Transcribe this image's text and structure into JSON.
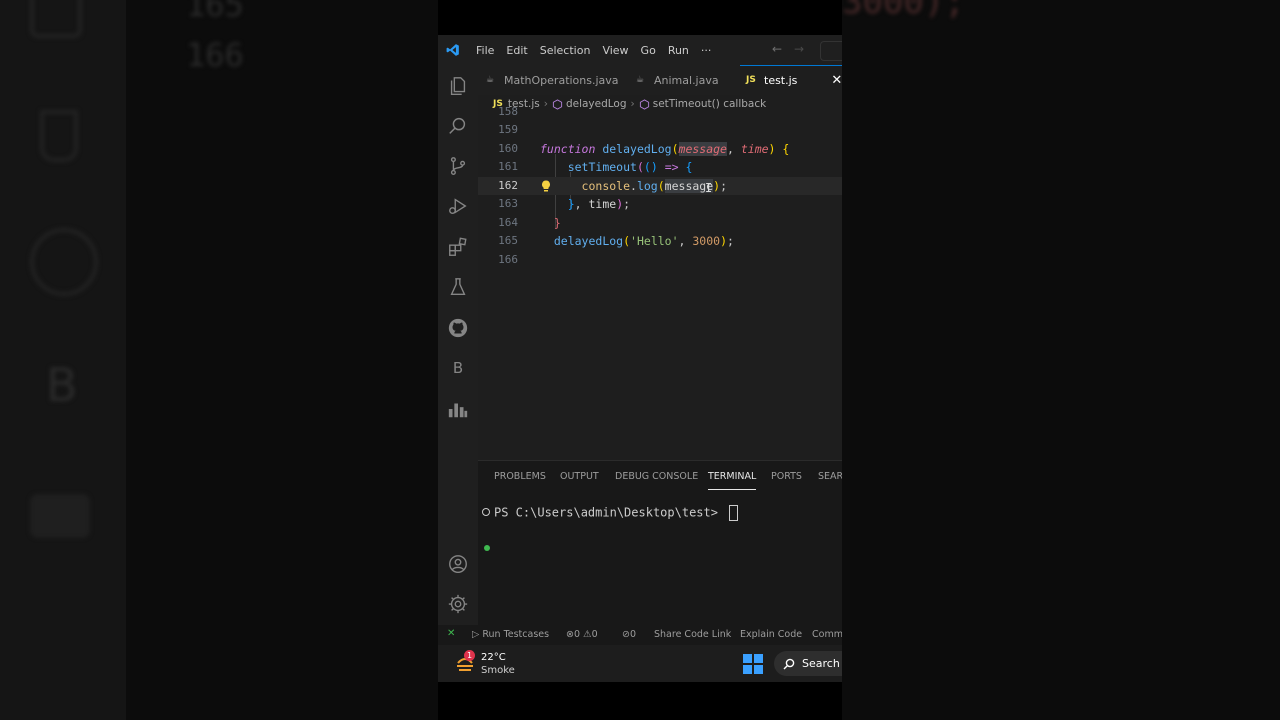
{
  "background_left": {
    "ghost_numbers": [
      "165",
      "166"
    ],
    "ghost_letter": "B"
  },
  "background_right": {
    "ghost_text": "3000);"
  },
  "titlebar": {
    "menu": [
      "File",
      "Edit",
      "Selection",
      "View",
      "Go",
      "Run",
      "···"
    ]
  },
  "tabs": [
    {
      "icon": "☕",
      "label": "MathOperations.java"
    },
    {
      "icon": "☕",
      "label": "Animal.java"
    },
    {
      "icon": "JS",
      "label": "test.js",
      "close": "✕"
    }
  ],
  "breadcrumb": {
    "file_icon": "JS",
    "file": "test.js",
    "symbol": "delayedLog",
    "callback": "setTimeout() callback"
  },
  "code": {
    "line_numbers": [
      "158",
      "159",
      "160",
      "161",
      "162",
      "163",
      "164",
      "165",
      "166"
    ],
    "current_line": "162"
  },
  "panel": {
    "tabs": [
      "PROBLEMS",
      "OUTPUT",
      "DEBUG CONSOLE",
      "TERMINAL",
      "PORTS",
      "SEAR"
    ],
    "active_tab": "TERMINAL",
    "terminal_prompt": "PS C:\\Users\\admin\\Desktop\\test> "
  },
  "statusbar": {
    "remote": "✕",
    "run_testcases": "Run Testcases",
    "errors": "0",
    "warnings": "0",
    "ports": "0",
    "share": "Share Code Link",
    "explain": "Explain Code",
    "comm": "Comm"
  },
  "taskbar": {
    "badge": "1",
    "temperature": "22°C",
    "condition": "Smoke",
    "search": "Search"
  },
  "colors": {
    "accent": "#0078d4",
    "editor_bg": "#1e1e1e",
    "js_badge": "#f1e05a",
    "terminal_dot": "#3fb950"
  }
}
